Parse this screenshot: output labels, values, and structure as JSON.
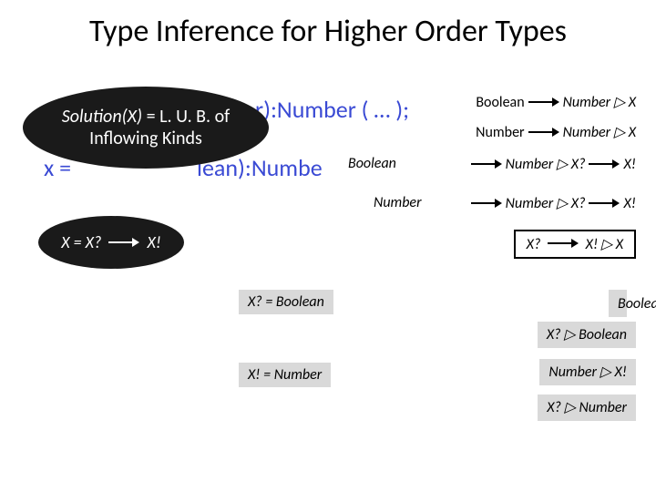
{
  "title": "Type Inference for Higher Order Types",
  "callout1": {
    "line1_lhs": "Solution(X)",
    "line1_rhs": " = L. U. B. of",
    "line2": "Inflowing Kinds"
  },
  "callout2": {
    "lhs": "X = X?",
    "rhs": "X!"
  },
  "bg": {
    "frag1": "r):Number ( … );",
    "frag2": "lean):Numbe"
  },
  "right": {
    "r1_l": "Boolean",
    "r1_r": "Number ▷ X",
    "r2_l": "Number",
    "r2_r": "Number ▷ X",
    "r3_l": "Number ▷ X?",
    "r3_r": "X!",
    "r4_l": "Number ▷ X?",
    "r4_r": "X!",
    "r5_l": "X?",
    "r5_r": "X! ▷ X"
  },
  "mid": {
    "m1": "Boolean",
    "m2": "Number"
  },
  "boxes": {
    "b1_lbl": "X? = Boolean",
    "b1_rule": "Boolean ▷ X?",
    "b2_rule": "X? ▷ Boolean",
    "b3_lbl": "X! = Number",
    "b3_rule": "Number ▷ X!",
    "b4_rule": "X? ▷ Number"
  }
}
